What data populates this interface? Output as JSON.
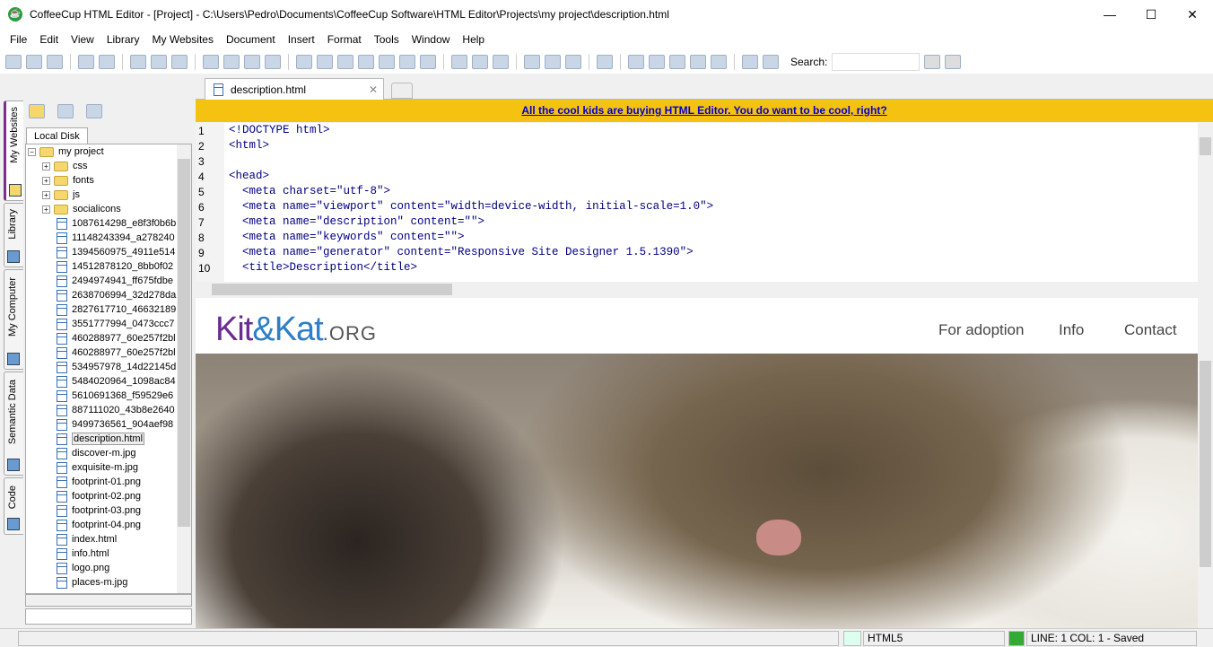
{
  "window": {
    "title": "CoffeeCup HTML Editor - [Project] - C:\\Users\\Pedro\\Documents\\CoffeeCup Software\\HTML Editor\\Projects\\my project\\description.html"
  },
  "menu": [
    "File",
    "Edit",
    "View",
    "Library",
    "My Websites",
    "Document",
    "Insert",
    "Format",
    "Tools",
    "Window",
    "Help"
  ],
  "toolbar": {
    "search_label": "Search:",
    "search_value": ""
  },
  "side_tabs": [
    "My Websites",
    "Library",
    "My Computer",
    "Semantic Data",
    "Code"
  ],
  "panel": {
    "tab": "Local Disk",
    "root": "my project",
    "folders": [
      "css",
      "fonts",
      "js",
      "socialicons"
    ],
    "files": [
      "1087614298_e8f3f0b6b",
      "11148243394_a278240",
      "1394560975_4911e514",
      "14512878120_8bb0f02",
      "2494974941_ff675fdbe",
      "2638706994_32d278da",
      "2827617710_46632189",
      "3551777994_0473ccc7",
      "460288977_60e257f2bl",
      "460288977_60e257f2bl",
      "534957978_14d22145d",
      "5484020964_1098ac84",
      "5610691368_f59529e6",
      "887111020_43b8e2640",
      "9499736561_904aef98",
      "description.html",
      "discover-m.jpg",
      "exquisite-m.jpg",
      "footprint-01.png",
      "footprint-02.png",
      "footprint-03.png",
      "footprint-04.png",
      "index.html",
      "info.html",
      "logo.png",
      "places-m.jpg"
    ],
    "selected": "description.html"
  },
  "editor": {
    "tab": "description.html",
    "banner": "All the cool kids are buying HTML Editor. You do want to be cool, right?",
    "lines": [
      "<!DOCTYPE html>",
      "<html>",
      "",
      "<head>",
      "  <meta charset=\"utf-8\">",
      "  <meta name=\"viewport\" content=\"width=device-width, initial-scale=1.0\">",
      "  <meta name=\"description\" content=\"\">",
      "  <meta name=\"keywords\" content=\"\">",
      "  <meta name=\"generator\" content=\"Responsive Site Designer 1.5.1390\">",
      "  <title>Description</title>"
    ]
  },
  "preview": {
    "logo": {
      "a": "Kit",
      "b": "&Kat",
      "c": ".ORG"
    },
    "nav": [
      "For adoption",
      "Info",
      "Contact"
    ]
  },
  "status": {
    "doctype": "HTML5",
    "position": "LINE: 1  COL: 1 - Saved"
  }
}
